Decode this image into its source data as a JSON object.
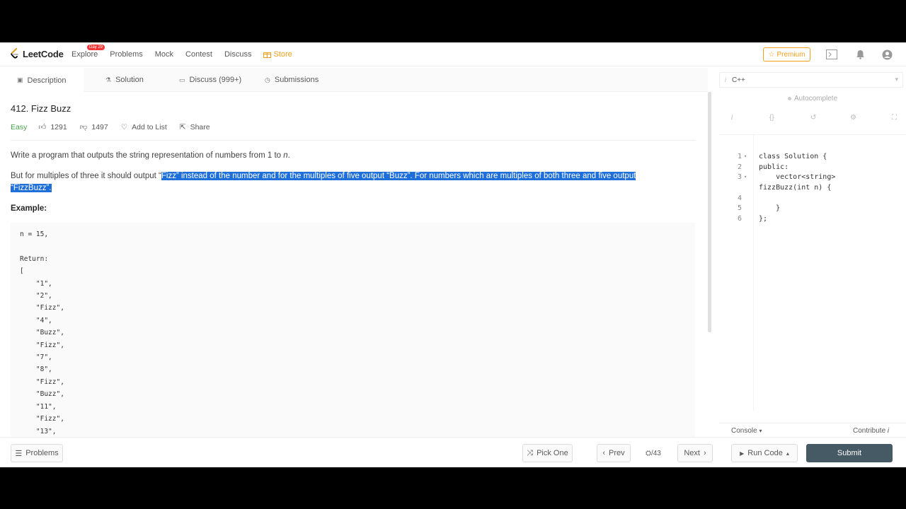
{
  "brand": {
    "logo_text": "LeetCode"
  },
  "nav": {
    "explore": "Explore",
    "explore_badge": "Day 29",
    "problems": "Problems",
    "mock": "Mock",
    "contest": "Contest",
    "discuss": "Discuss",
    "store": "Store",
    "premium": "Premium"
  },
  "tabs": {
    "description": "Description",
    "solution": "Solution",
    "discuss": "Discuss (999+)",
    "submissions": "Submissions"
  },
  "problem": {
    "title": "412. Fizz Buzz",
    "difficulty": "Easy",
    "likes": "1291",
    "dislikes": "1497",
    "add_to_list": "Add to List",
    "share": "Share",
    "para1_a": "Write a program that outputs the string representation of numbers from 1 to ",
    "para1_n": "n",
    "para1_b": ".",
    "para2_a": "But for multiples of three it should output “",
    "para2_hl1": "Fizz” instead of the number and for the multiples of five output “Buzz”. For numbers which are multiples of both three and five output",
    "para2_hl2": "“FizzBuzz”.",
    "example_label": "Example:",
    "example_code": "n = 15,\n\nReturn:\n[\n    \"1\",\n    \"2\",\n    \"Fizz\",\n    \"4\",\n    \"Buzz\",\n    \"Fizz\",\n    \"7\",\n    \"8\",\n    \"Fizz\",\n    \"Buzz\",\n    \"11\",\n    \"Fizz\",\n    \"13\","
  },
  "editor": {
    "language": "C++",
    "autocomplete": "Autocomplete",
    "lines": [
      {
        "num": "1",
        "fold": "▾",
        "text": "class Solution {"
      },
      {
        "num": "2",
        "fold": "",
        "text": "public:"
      },
      {
        "num": "3",
        "fold": "▾",
        "text": "    vector<string>"
      },
      {
        "num": "",
        "fold": "",
        "text": "fizzBuzz(int n) {"
      },
      {
        "num": "4",
        "fold": "",
        "text": ""
      },
      {
        "num": "5",
        "fold": "",
        "text": "    }"
      },
      {
        "num": "6",
        "fold": "",
        "text": "};"
      }
    ],
    "console": "Console",
    "contribute": "Contribute"
  },
  "bottom": {
    "problems": "Problems",
    "pick_one": "Pick One",
    "prev": "Prev",
    "page": "/43",
    "next": "Next",
    "run_code": "Run Code",
    "submit": "Submit"
  },
  "colors": {
    "store": "#f0a01e",
    "highlight": "#1e6fd9",
    "submit": "#455a64",
    "easy": "#43a047"
  }
}
